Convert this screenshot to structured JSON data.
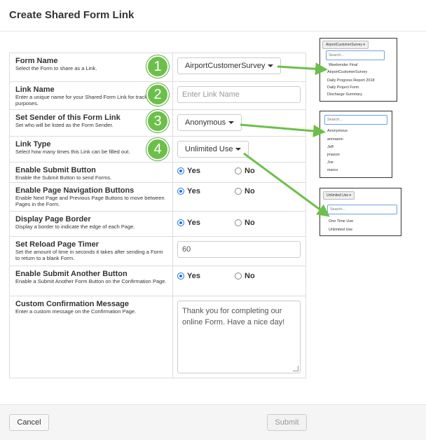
{
  "modal": {
    "title": "Create Shared Form Link"
  },
  "rows": {
    "form_name": {
      "title": "Form Name",
      "desc": "Select the Form to share as a Link.",
      "value": "AirportCustomerSurvey"
    },
    "link_name": {
      "title": "Link Name",
      "desc": "Enter a unique name for your Shared Form Link for tracking purposes.",
      "placeholder": "Enter Link Name"
    },
    "sender": {
      "title": "Set Sender of this Form Link",
      "desc": "Set who will be listed as the Form Sender.",
      "value": "Anonymous"
    },
    "link_type": {
      "title": "Link Type",
      "desc": "Select how many times this Link can be filled out.",
      "value": "Unlimited Use"
    },
    "submit_button": {
      "title": "Enable Submit Button",
      "desc": "Enable the Submit Button to send Forms.",
      "yes": "Yes",
      "no": "No",
      "selected": "Yes"
    },
    "page_nav": {
      "title": "Enable Page Navigation Buttons",
      "desc": "Enable Next Page and Previous Page Buttons to move between Pages in the Form.",
      "yes": "Yes",
      "no": "No",
      "selected": "Yes"
    },
    "page_border": {
      "title": "Display Page Border",
      "desc": "Display a border to indicate the edge of each Page.",
      "yes": "Yes",
      "no": "No",
      "selected": "Yes"
    },
    "reload_timer": {
      "title": "Set Reload Page Timer",
      "desc": "Set the amount of time in seconds it takes after sending a Form to return to a blank Form.",
      "value": "60"
    },
    "submit_another": {
      "title": "Enable Submit Another Button",
      "desc": "Enable a Submit Another Form Button on the Confirmation Page.",
      "yes": "Yes",
      "no": "No",
      "selected": "Yes"
    },
    "confirmation": {
      "title": "Custom Confirmation Message",
      "desc": "Enter a custom message on the Confirmation Page.",
      "value": "Thank you for completing our online Form. Have a nice day!"
    }
  },
  "badges": [
    "1",
    "2",
    "3",
    "4"
  ],
  "footer": {
    "cancel_label": "Cancel",
    "submit_label": "Submit"
  },
  "popups": {
    "forms": {
      "button": "AirportCustomerSurvey",
      "search_placeholder": "Search...",
      "items": [
        "Weekender Final",
        "AirportCustomerSurvey",
        "Daily Progress Report 2018",
        "Daily Project Form",
        "Discharge Summary"
      ]
    },
    "senders": {
      "search_placeholder": "Search...",
      "items": [
        "Anonymous",
        "anmason",
        "Jeff",
        "jmason",
        "Joe",
        "marco"
      ]
    },
    "link_types": {
      "button": "Unlimited Use",
      "search_placeholder": "Search...",
      "items": [
        "One Time Use",
        "Unlimited Use"
      ]
    }
  },
  "colors": {
    "badge": "#6cc04a",
    "arrow": "#6cc04a",
    "radio_selected": "#1a73e8"
  }
}
